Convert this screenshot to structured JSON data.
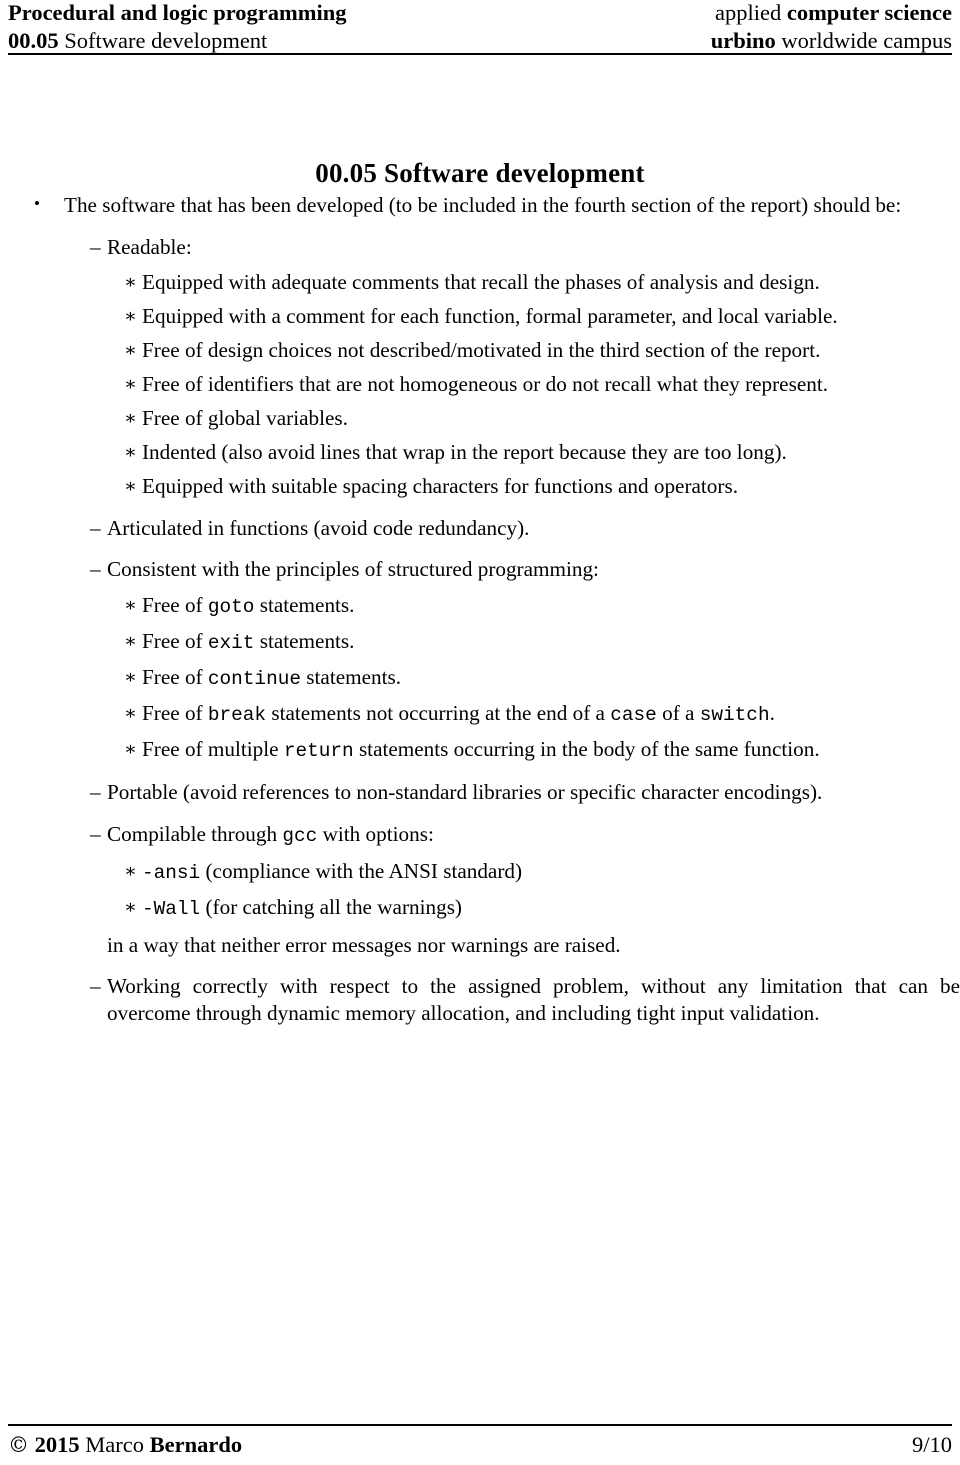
{
  "header": {
    "left_line1": "Procedural and logic programming",
    "left_line2_bold": "00.05",
    "left_line2_rest": "Software development",
    "right_line1_regular": "applied",
    "right_line1_bold": "computer science",
    "right_line2_bold": "urbino",
    "right_line2_regular": "worldwide campus"
  },
  "title": "00.05 Software development",
  "content": {
    "bullet_marker": "•",
    "dash_marker": "–",
    "star_marker": "∗",
    "intro": "The software that has been developed (to be included in the fourth section of the report) should be:",
    "readable_label": "Readable:",
    "readable_items": [
      "Equipped with adequate comments that recall the phases of analysis and design.",
      "Equipped with a comment for each function, formal parameter, and local variable.",
      "Free of design choices not described/motivated in the third section of the report.",
      "Free of identifiers that are not homogeneous or do not recall what they represent.",
      "Free of global variables.",
      "Indented (also avoid lines that wrap in the report because they are too long).",
      "Equipped with suitable spacing characters for functions and operators."
    ],
    "articulated": "Articulated in functions (avoid code redundancy).",
    "structured_label": "Consistent with the principles of structured programming:",
    "structured_items": [
      {
        "pre": "Free of ",
        "code": "goto",
        "post": " statements."
      },
      {
        "pre": "Free of ",
        "code": "exit",
        "post": " statements."
      },
      {
        "pre": "Free of ",
        "code": "continue",
        "post": " statements."
      },
      {
        "pre": "Free of ",
        "code": "break",
        "mid1": " statements not occurring at the end of a ",
        "code2": "case",
        "mid2": " of a ",
        "code3": "switch",
        "post": "."
      },
      {
        "pre": "Free of multiple ",
        "code": "return",
        "post": " statements occurring in the body of the same function."
      }
    ],
    "portable": "Portable (avoid references to non-standard libraries or specific character encodings).",
    "compilable_pre": "Compilable through ",
    "compilable_code": "gcc",
    "compilable_post": " with options:",
    "options": [
      {
        "code": "-ansi",
        "post": " (compliance with the ANSI standard)"
      },
      {
        "code": "-Wall",
        "post": " (for catching all the warnings)"
      }
    ],
    "options_tail": "in a way that neither error messages nor warnings are raised.",
    "working": "Working correctly with respect to the assigned problem, without any limitation that can be overcome through dynamic memory allocation, and including tight input validation."
  },
  "footer": {
    "copyright_symbol": "©",
    "year": "2015",
    "author_first": "Marco",
    "author_last": "Bernardo",
    "page_number": "9/10"
  }
}
